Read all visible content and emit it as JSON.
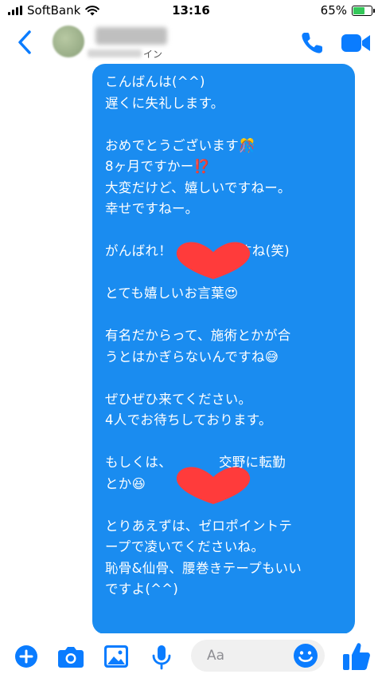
{
  "status_bar": {
    "carrier": "SoftBank",
    "time": "13:16",
    "battery": "65%",
    "battery_level": 0.65
  },
  "header": {
    "substatus_suffix": "イン"
  },
  "message": {
    "lines": [
      "こんばんは(^^)",
      "遅くに失礼します。",
      "",
      "おめでとうございます🎊",
      "8ヶ月ですかー⁉️",
      "大変だけど、嬉しいですねー。",
      "幸せですねー。",
      "",
      "がんばれ！　　　　ですね(笑)",
      "",
      "とても嬉しいお言葉😍",
      "",
      "有名だからって、施術とかが合",
      "うとはかぎらないんですね😅",
      "",
      "ぜひぜひ来てください。",
      "4人でお待ちしております。",
      "",
      "もしくは、　　　　交野に転勤",
      "とか😆",
      "",
      "とりあえずは、ゼロポイントテ",
      "ープで凌いでくださいね。",
      "恥骨&仙骨、腰巻きテープもいい",
      "ですよ(^^)"
    ]
  },
  "composer": {
    "placeholder": "Aa"
  },
  "colors": {
    "accent": "#0a7cff",
    "bubble": "#1a8cf0",
    "redact": "#ff3b3b"
  }
}
